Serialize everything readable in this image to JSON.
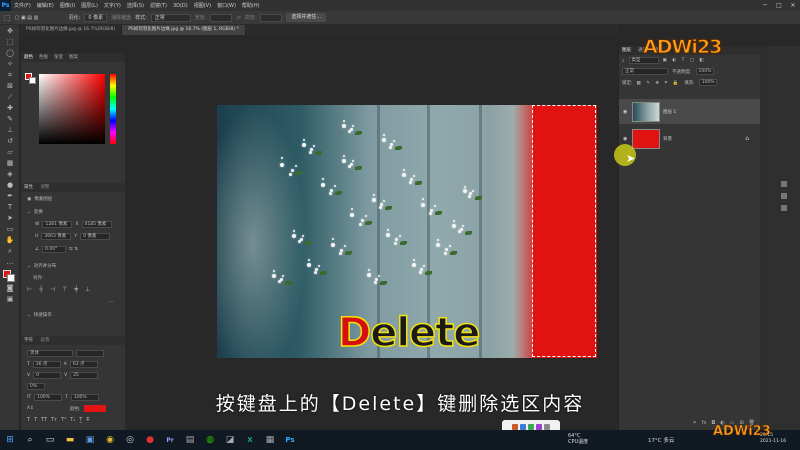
{
  "app": {
    "logo": "Ps",
    "menu": [
      "文件(F)",
      "编辑(E)",
      "图像(I)",
      "图层(L)",
      "文字(Y)",
      "选择(S)",
      "滤镜(T)",
      "3D(D)",
      "视图(V)",
      "窗口(W)",
      "帮助(H)"
    ],
    "window_controls": [
      "─",
      "□",
      "✕"
    ]
  },
  "options_bar": {
    "feather_label": "羽化:",
    "feather_value": "0 像素",
    "antialias": "消除锯齿",
    "style_label": "样式:",
    "style_value": "正常",
    "width_label": "宽度:",
    "height_label": "高度:",
    "select_mask_button": "选择并遮住..."
  },
  "tabs": [
    {
      "label": "PS如何羽化图片边缘.jpg @ 16.7%(RGB/8)",
      "active": false
    },
    {
      "label": "PS如何羽化图片边缘.jpg @ 16.7% (图层 1, RGB/8) *",
      "active": true
    }
  ],
  "color_panel": {
    "tabs": [
      "颜色",
      "色板",
      "渐变",
      "图案"
    ],
    "foreground": "#e31414",
    "background": "#ffffff"
  },
  "properties_panel": {
    "tabs": [
      "属性",
      "调整"
    ],
    "layer_type": "像素图层",
    "transform_header": "变换",
    "w_label": "W",
    "w_value": "1281 像素",
    "x_label": "X",
    "x_value": "4185 像素",
    "h_label": "H",
    "h_value": "3663 像素",
    "y_label": "Y",
    "y_value": "0 像素",
    "angle_value": "0.00°",
    "align_header": "对齐并分布",
    "align_sub": "对齐:",
    "quick_header": "快速操作"
  },
  "char_panel": {
    "tabs": [
      "字符",
      "段落"
    ],
    "font": "黑体",
    "size": "36 点",
    "leading": "63 点",
    "tracking": "0",
    "kerning": "25",
    "scale_h": "100%",
    "scale_v": "100%",
    "color_label": "颜色:"
  },
  "canvas": {
    "overlay_text_first": "D",
    "overlay_text_rest": "elete",
    "fill_color": "#e01212"
  },
  "layers_panel": {
    "tabs": [
      "图层",
      "通道",
      "路径"
    ],
    "kind": "类型",
    "blend_mode": "正常",
    "opacity_label": "不透明度:",
    "opacity_value": "100%",
    "lock_label": "锁定:",
    "fill_label": "填充:",
    "fill_value": "100%",
    "layers": [
      {
        "name": "图层 1",
        "visible": true,
        "selected": true
      },
      {
        "name": "背景",
        "visible": true,
        "selected": false
      }
    ]
  },
  "subtitle": "按键盘上的【Delete】键删除选区内容",
  "brand": "ADWi23",
  "taskbar": {
    "temp": "64°C",
    "cpu": "CPU温度",
    "weather": "17°C 多云",
    "time": "23:15",
    "date": "2021-11-16"
  }
}
